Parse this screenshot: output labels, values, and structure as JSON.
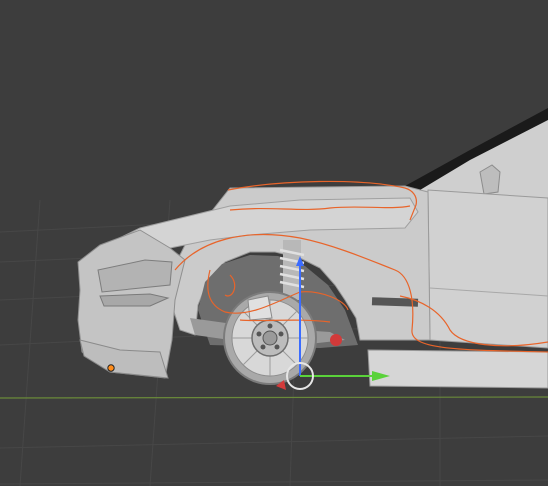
{
  "viewport": {
    "background": "#3d3d3d",
    "grid_color": "#474747",
    "x_axis_color": "#6a8a3a"
  },
  "scene": {
    "object": "car-front-model",
    "body_color": "#c9c9c9",
    "shadow_color": "#8a8a8a",
    "selection_outline_color": "#e8642a",
    "selected_part": "front-wheel-suspension"
  },
  "gizmo": {
    "type": "move",
    "x_axis_color": "#5ad23a",
    "z_axis_color": "#3b6cff",
    "y_axis_color": "#d23a3a",
    "center_ring_color": "#e6e6e6"
  },
  "origin_point_color": "#ff8c1a"
}
